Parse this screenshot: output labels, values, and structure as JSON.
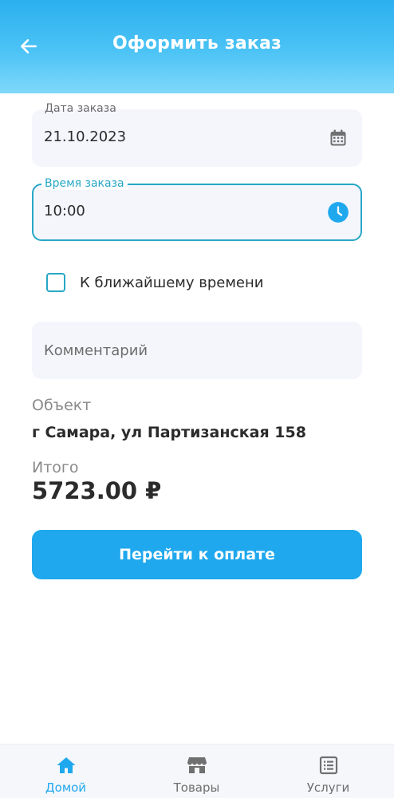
{
  "header": {
    "title": "Оформить заказ",
    "back_icon": "arrow-left-icon"
  },
  "form": {
    "date": {
      "label": "Дата заказа",
      "value": "21.10.2023",
      "icon": "calendar-icon"
    },
    "time": {
      "label": "Время заказа",
      "value": "10:00",
      "icon": "clock-icon"
    },
    "nearest_time": {
      "label": "К ближайшему времени",
      "checked": false
    },
    "comment": {
      "placeholder": "Комментарий",
      "value": ""
    }
  },
  "summary": {
    "object_label": "Объект",
    "object_value": "г Самара, ул Партизанская 158",
    "total_label": "Итого",
    "total_value": "5723.00 ₽"
  },
  "actions": {
    "pay_label": "Перейти к оплате"
  },
  "bottom_nav": {
    "items": [
      {
        "label": "Домой",
        "icon": "home-icon",
        "active": true
      },
      {
        "label": "Товары",
        "icon": "store-icon",
        "active": false
      },
      {
        "label": "Услуги",
        "icon": "list-icon",
        "active": false
      }
    ]
  },
  "colors": {
    "accent": "#1fa8ee",
    "focus": "#27a7c6",
    "field_bg": "#f4f6fc"
  }
}
